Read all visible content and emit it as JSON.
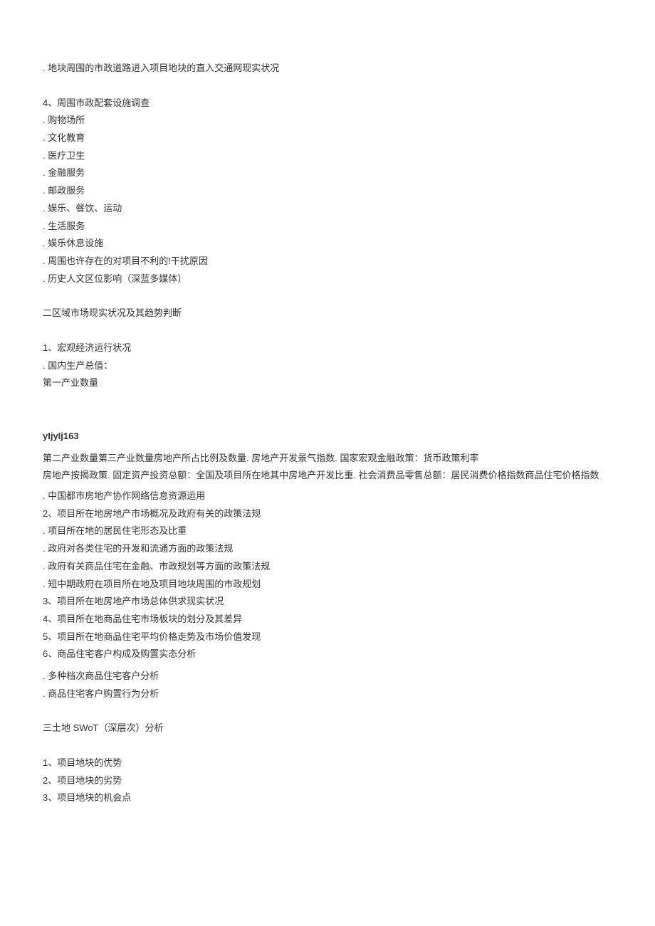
{
  "top_line": ". 地块周围的市政道路进入项目地块的直入交通网现实状况",
  "section4_title": "4、周围市政配套设施调查",
  "section4_items": [
    ". 购物场所",
    ". 文化教育",
    ". 医疗卫生",
    ". 金融服务",
    ". 邮政服务",
    ". 娱乐、餐饮、运动",
    ". 生活服务",
    ". 娱乐休息设施",
    ". 周围也许存在的对项目不利的!干扰原因",
    ". 历史人文区位影响（深蓝多媒体）"
  ],
  "section_area_title": "二区域市场现实状况及其趋势判断",
  "macro_title": "1、宏观经济运行状况",
  "macro_items": [
    ". 国内生产总值：",
    "第一产业数量"
  ],
  "code_header": "yIjyIj163",
  "para1": "第二产业数量第三产业数量房地产所占比例及数量. 房地产开发景气指数. 国家宏观金融政策：货币政策利率",
  "para2": "房地产按揭政策. 固定资产投资总额：全国及项目所在地其中房地产开发比重. 社会消费品零售总额：居民消费价格指数商品住宅价格指数",
  "list2": [
    ". 中国都市房地产协作网络信息资源运用",
    "2、项目所在地房地产市场概况及政府有关的政策法规",
    ". 项目所在地的居民住宅形态及比重",
    ". 政府对各类住宅的开发和流通方面的政策法规",
    ". 政府有关商品住宅在金融、市政规划等方面的政策法规",
    ". 短中期政府在项目所在地及项目地块周围的市政规划",
    "3、项目所在地房地产市场总体供求现实状况",
    "4、项目所在地商品住宅市场板块的划分及其差异",
    "5、项目所在地商品住宅平均价格走势及市场价值发现",
    "6、商品住宅客户构成及购置实态分析"
  ],
  "list3": [
    ". 多种档次商品住宅客户分析",
    ". 商品住宅客户购置行为分析"
  ],
  "swot_title": "三土地 SWoT（深层次）分析",
  "swot_items": [
    "1、项目地块的优势",
    "2、项目地块的劣势",
    "3、项目地块的机会点"
  ]
}
